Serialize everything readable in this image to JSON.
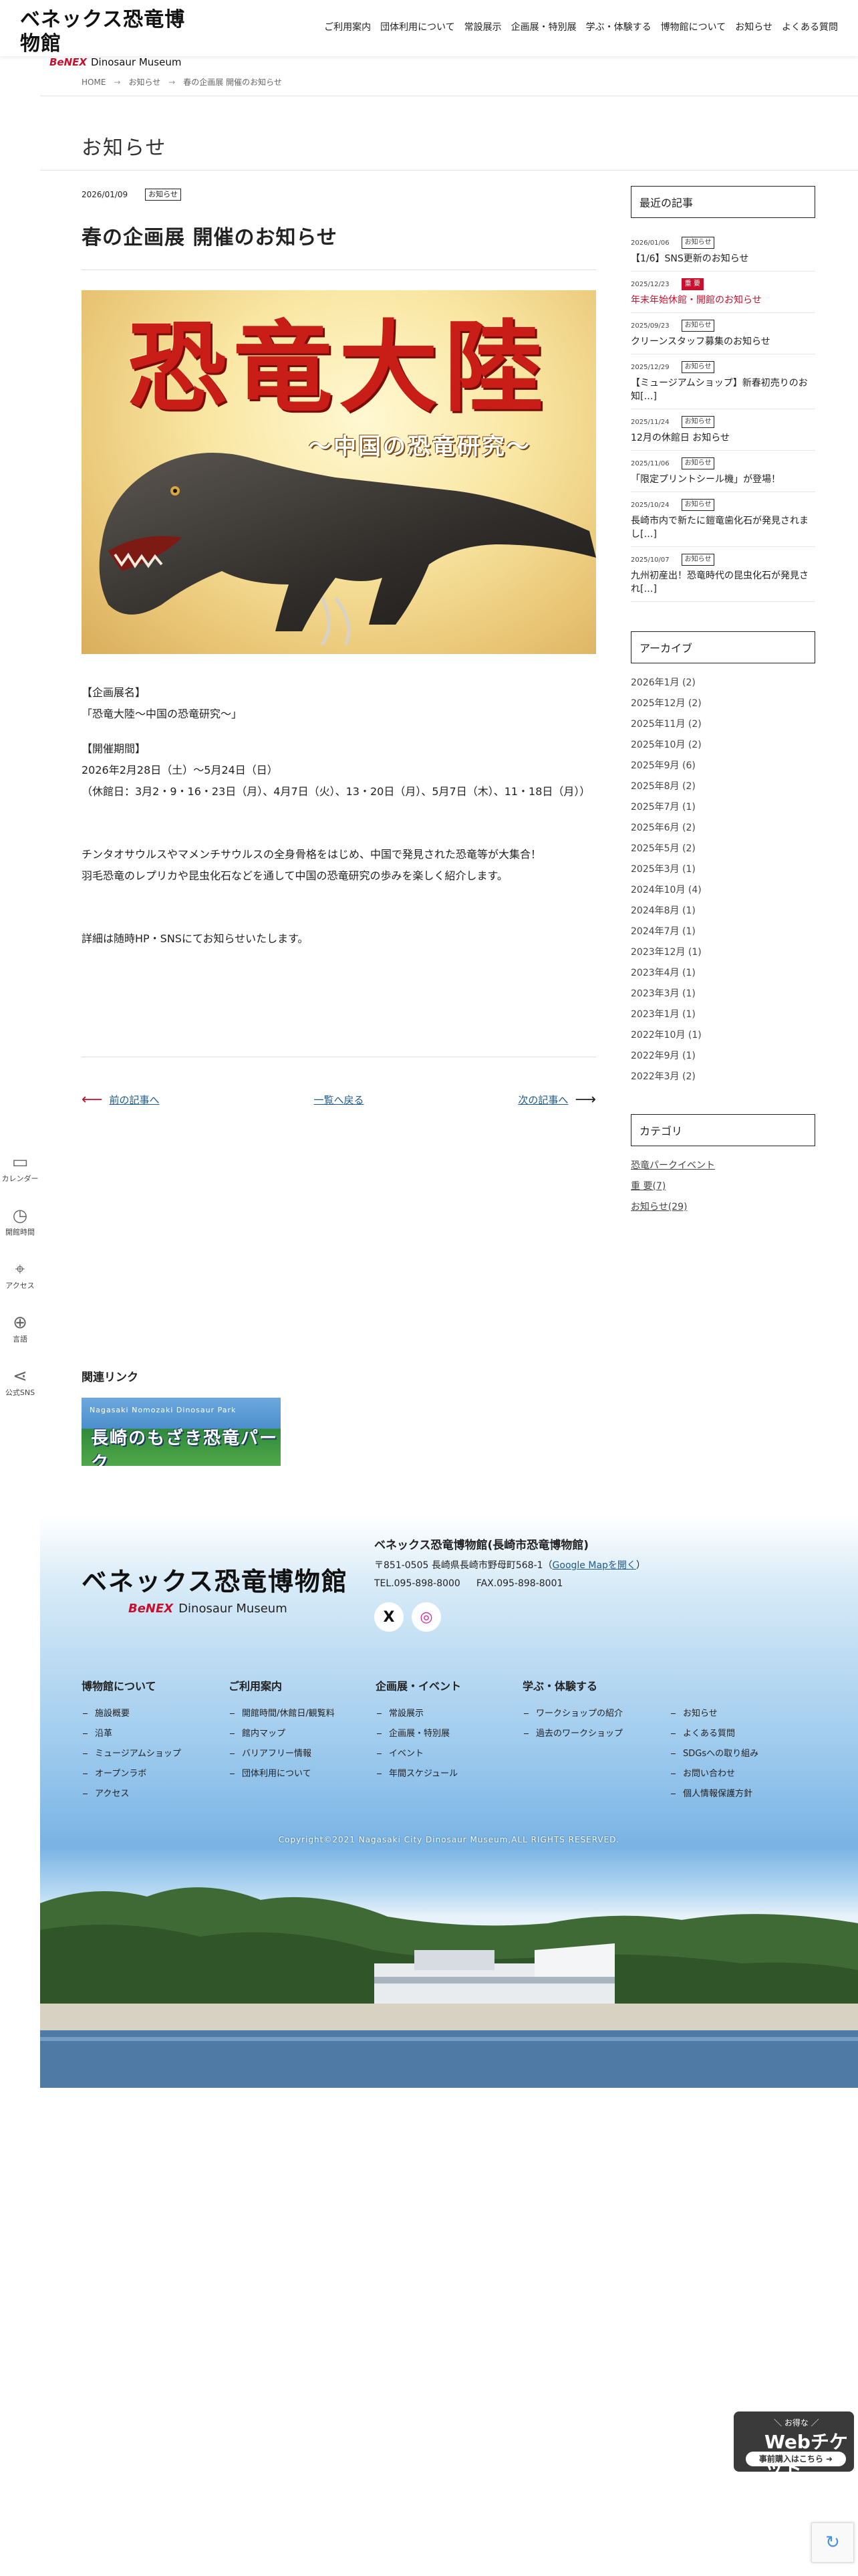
{
  "header": {
    "logo_jp": "ベネックス恐竜博物館",
    "logo_benex": "BeNEX",
    "logo_en": "Dinosaur Museum",
    "nav": [
      "ご利用案内",
      "団体利用について",
      "常設展示",
      "企画展・特別展",
      "学ぶ・体験する",
      "博物館について",
      "お知らせ",
      "よくある質問"
    ]
  },
  "breadcrumb": {
    "home": "HOME",
    "sep": "→",
    "news": "お知らせ",
    "current": "春の企画展 開催のお知らせ"
  },
  "page_title": "お知らせ",
  "post": {
    "date": "2026/01/09",
    "tag": "お知らせ",
    "title": "春の企画展 開催のお知らせ",
    "hero_title": "恐竜大陸",
    "hero_sub": "〜中国の恐竜研究〜",
    "body": [
      "【企画展名】",
      "「恐竜大陸〜中国の恐竜研究〜」",
      "【開催期間】",
      "2026年2月28日（土）〜5月24日（日）",
      "（休館日：3月2・9・16・23日（月）、4月7日（火）、13・20日（月）、5月7日（木）、11・18日（月））",
      "チンタオサウルスやマメンチサウルスの全身骨格をはじめ、中国で発見された恐竜等が大集合！",
      "羽毛恐竜のレプリカや昆虫化石などを通して中国の恐竜研究の歩みを楽しく紹介します。",
      "詳細は随時HP・SNSにてお知らせいたします。"
    ],
    "prev": "前の記事へ",
    "list": "一覧へ戻る",
    "next": "次の記事へ"
  },
  "sidebar": {
    "recent_title": "最近の記事",
    "recent": [
      {
        "date": "2026/01/06",
        "tag": "お知らせ",
        "title": "【1/6】SNS更新のお知らせ",
        "important": false
      },
      {
        "date": "2025/12/23",
        "tag": "重 要",
        "title": "年末年始休館・開館のお知らせ",
        "important": true
      },
      {
        "date": "2025/09/23",
        "tag": "お知らせ",
        "title": "クリーンスタッフ募集のお知らせ",
        "important": false
      },
      {
        "date": "2025/12/29",
        "tag": "お知らせ",
        "title": "【ミュージアムショップ】新春初売りのお知[…]",
        "important": false
      },
      {
        "date": "2025/11/24",
        "tag": "お知らせ",
        "title": "12月の休館日 お知らせ",
        "important": false
      },
      {
        "date": "2025/11/06",
        "tag": "お知らせ",
        "title": "「限定プリントシール機」が登場！",
        "important": false
      },
      {
        "date": "2025/10/24",
        "tag": "お知らせ",
        "title": "長崎市内で新たに鎧竜歯化石が発見されまし[…]",
        "important": false
      },
      {
        "date": "2025/10/07",
        "tag": "お知らせ",
        "title": "九州初産出！恐竜時代の昆虫化石が発見され[…]",
        "important": false
      }
    ],
    "archive_title": "アーカイブ",
    "archive": [
      "2026年1月 (2)",
      "2025年12月 (2)",
      "2025年11月 (2)",
      "2025年10月 (2)",
      "2025年9月 (6)",
      "2025年8月 (2)",
      "2025年7月 (1)",
      "2025年6月 (2)",
      "2025年5月 (2)",
      "2025年3月 (1)",
      "2024年10月 (4)",
      "2024年8月 (1)",
      "2024年7月 (1)",
      "2023年12月 (1)",
      "2023年4月 (1)",
      "2023年3月 (1)",
      "2023年1月 (1)",
      "2022年10月 (1)",
      "2022年9月 (1)",
      "2022年3月 (2)"
    ],
    "category_title": "カテゴリ",
    "categories": [
      "恐竜パークイベント",
      "重 要(7)",
      "お知らせ(29)"
    ]
  },
  "left_nav": [
    {
      "icon": "calendar-icon",
      "label": "カレンダー"
    },
    {
      "icon": "clock-icon",
      "label": "開館時間"
    },
    {
      "icon": "map-pin-icon",
      "label": "アクセス"
    },
    {
      "icon": "globe-icon",
      "label": "言語"
    },
    {
      "icon": "share-icon",
      "label": "公式SNS"
    }
  ],
  "related": {
    "title": "関連リンク",
    "banner_small": "Nagasaki Nomozaki Dinosaur Park",
    "banner_big": "長崎のもざき恐竜パーク"
  },
  "footer": {
    "logo_jp": "ベネックス恐竜博物館",
    "logo_benex": "BeNEX",
    "logo_en": "Dinosaur Museum",
    "name": "ベネックス恐竜博物館(長崎市恐竜博物館)",
    "address": "〒851-0505 長崎県長崎市野母町568-1（",
    "map_link": "Google Mapを開く",
    "address_end": "）",
    "tel": "TEL.095-898-8000",
    "fax": "FAX.095-898-8001",
    "sns_x": "X",
    "sns_ig": "◎",
    "columns": [
      {
        "title": "博物館について",
        "items": [
          "施設概要",
          "沿革",
          "ミュージアムショップ",
          "オープンラボ",
          "アクセス"
        ]
      },
      {
        "title": "ご利用案内",
        "items": [
          "開館時間/休館日/観覧料",
          "館内マップ",
          "バリアフリー情報",
          "団体利用について"
        ]
      },
      {
        "title": "企画展・イベント",
        "items": [
          "常設展示",
          "企画展・特別展",
          "イベント",
          "年間スケジュール"
        ]
      },
      {
        "title": "学ぶ・体験する",
        "items": [
          "ワークショップの紹介",
          "過去のワークショップ"
        ]
      },
      {
        "title": "",
        "items": [
          "お知らせ",
          "よくある質問",
          "SDGsへの取り組み",
          "お問い合わせ",
          "個人情報保護方針"
        ]
      }
    ],
    "copyright": "Copyright©2021 Nagasaki City Dinosaur Museum,ALL RIGHTS RESERVED."
  },
  "ticket": {
    "small": "＼ お得な ／",
    "big": "Webチケット",
    "button": "事前購入はこちら ➜"
  }
}
